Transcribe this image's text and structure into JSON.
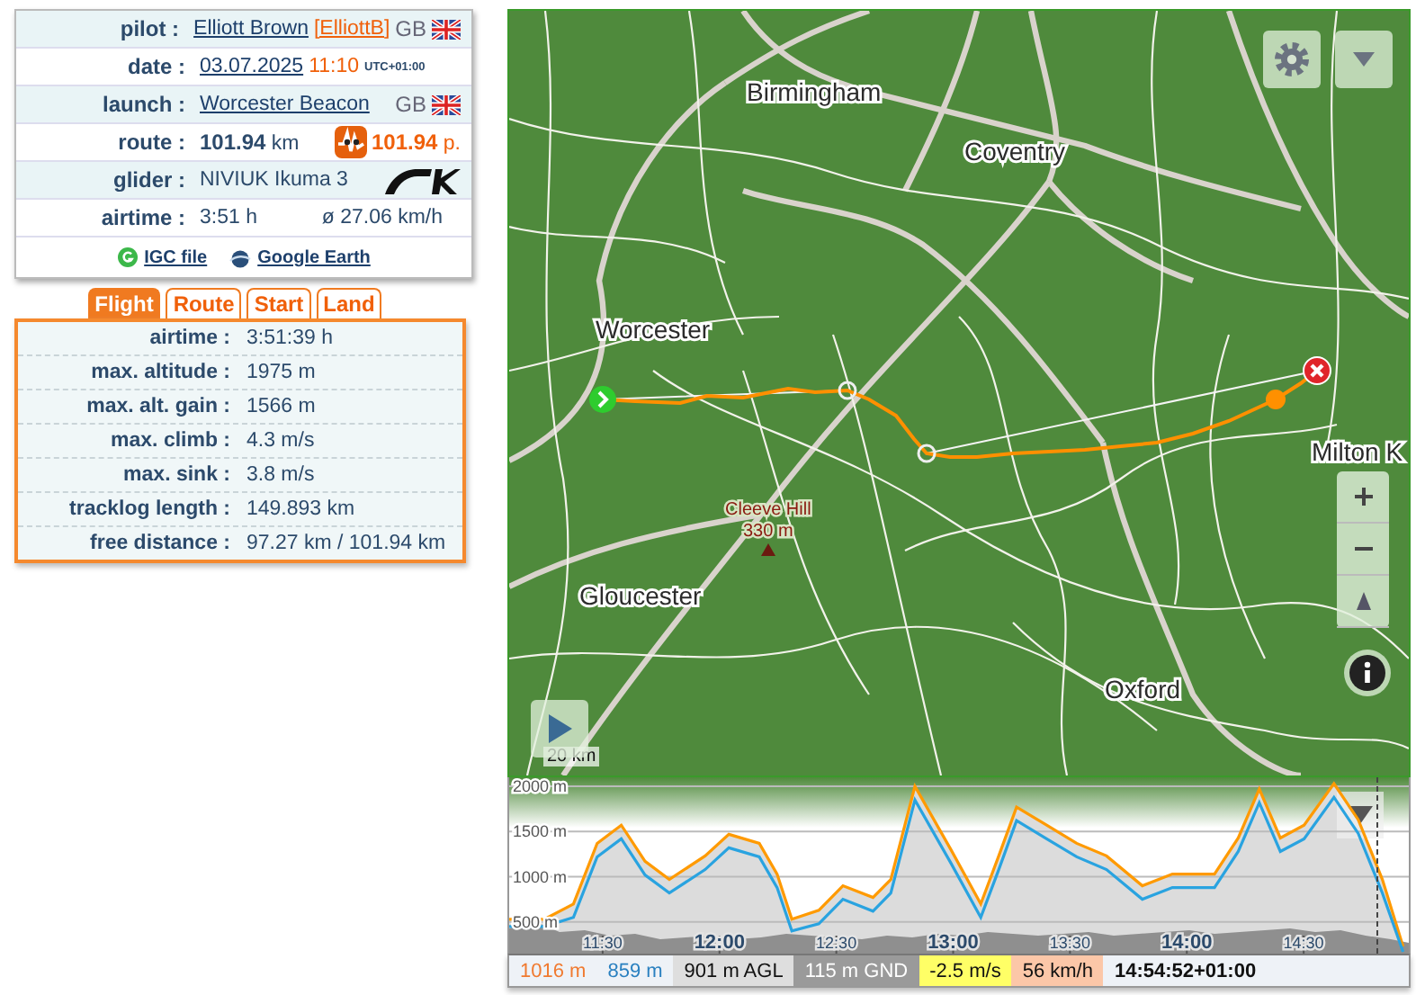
{
  "flight_info": {
    "rows": [
      {
        "kind": "pilot",
        "label": "pilot :",
        "name": "Elliott Brown",
        "nickname": "[ElliottB]",
        "country": "GB"
      },
      {
        "kind": "date",
        "label": "date :",
        "date": "03.07.2025",
        "time": "11:10",
        "timezone": "UTC+01:00"
      },
      {
        "kind": "launch",
        "label": "launch :",
        "site": "Worcester Beacon",
        "country": "GB"
      },
      {
        "kind": "route",
        "label": "route :",
        "distance": "101.94",
        "unit": "km",
        "points": "101.94",
        "points_unit": "p."
      },
      {
        "kind": "glider",
        "label": "glider :",
        "glider": "NIVIUK Ikuma 3"
      },
      {
        "kind": "airtime",
        "label": "airtime :",
        "duration": "3:51 h",
        "average_speed": "ø 27.06 km/h"
      }
    ],
    "links": [
      {
        "kind": "igc",
        "text": "IGC file"
      },
      {
        "kind": "earth",
        "text": "Google Earth"
      }
    ]
  },
  "tabs": [
    {
      "label": "Flight",
      "selected": true
    },
    {
      "label": "Route",
      "selected": false
    },
    {
      "label": "Start",
      "selected": false
    },
    {
      "label": "Land",
      "selected": false
    }
  ],
  "stats": [
    {
      "label": "airtime :",
      "value": "3:51:39 h"
    },
    {
      "label": "max. altitude :",
      "value": "1975 m"
    },
    {
      "label": "max. alt. gain :",
      "value": "1566 m"
    },
    {
      "label": "max. climb :",
      "value": "4.3 m/s"
    },
    {
      "label": "max. sink :",
      "value": "3.8 m/s"
    },
    {
      "label": "tracklog length :",
      "value": "149.893 km"
    },
    {
      "label": "free distance :",
      "value": "97.27 km / 101.94 km"
    }
  ],
  "map": {
    "places": [
      {
        "kind": "city",
        "name": "Birmingham"
      },
      {
        "kind": "city",
        "name": "Coventry"
      },
      {
        "kind": "city",
        "name": "Worcester"
      },
      {
        "kind": "city",
        "name": "Milton K"
      },
      {
        "kind": "city",
        "name": "Gloucester"
      },
      {
        "kind": "city",
        "name": "Oxford"
      },
      {
        "kind": "peak",
        "name": "Cleeve Hill",
        "elevation": "330 m"
      }
    ],
    "scale": "20 km"
  },
  "elevation_chart": {
    "chart_data": {
      "type": "line",
      "x": [
        666,
        675,
        682.5,
        688.6,
        694.8,
        700.9,
        707.1,
        716.3,
        722.4,
        730.2,
        734.8,
        738.6,
        745.5,
        751.7,
        759.4,
        764,
        770.2,
        779.4,
        787.1,
        791.7,
        796.3,
        804,
        811.7,
        819.4,
        828.6,
        836.3,
        847.1,
        853.2,
        858.6,
        864,
        870.1,
        877.8,
        884,
        890.2,
        895.5
      ],
      "series": [
        {
          "color": "#ff9a00",
          "values": [
            530,
            530,
            700,
            1370,
            1570,
            1170,
            970,
            1230,
            1470,
            1370,
            1030,
            530,
            630,
            900,
            770,
            970,
            2000,
            1300,
            700,
            1230,
            1770,
            1570,
            1370,
            1230,
            900,
            1030,
            1030,
            1430,
            1970,
            1430,
            1570,
            2030,
            1630,
            970,
            230
          ]
        },
        {
          "color": "#29a3e0",
          "values": [
            450,
            450,
            550,
            1220,
            1420,
            1020,
            820,
            1080,
            1320,
            1220,
            880,
            400,
            480,
            750,
            620,
            820,
            1850,
            1150,
            550,
            1080,
            1620,
            1420,
            1220,
            1080,
            750,
            880,
            880,
            1280,
            1820,
            1280,
            1420,
            1880,
            1480,
            820,
            170
          ]
        }
      ],
      "xlim": [
        666,
        897
      ],
      "ylim": [
        150,
        2100
      ],
      "grid": true,
      "xticks": [
        {
          "value": 690,
          "label": "11:30"
        },
        {
          "value": 720,
          "label": "12:00"
        },
        {
          "value": 750,
          "label": "12:30"
        },
        {
          "value": 780,
          "label": "13:00"
        },
        {
          "value": 810,
          "label": "13:30"
        },
        {
          "value": 840,
          "label": "14:00"
        },
        {
          "value": 870,
          "label": "14:30"
        }
      ],
      "yticks": [
        {
          "value": 500,
          "label": "500 m"
        },
        {
          "value": 1000,
          "label": "1000 m"
        },
        {
          "value": 1500,
          "label": "1500 m"
        },
        {
          "value": 2000,
          "label": "2000 m"
        }
      ]
    }
  },
  "status_bar": [
    {
      "kind": "gps",
      "text": "1016 m"
    },
    {
      "kind": "baro",
      "text": "859 m"
    },
    {
      "kind": "agl",
      "text": "901 m AGL"
    },
    {
      "kind": "gnd",
      "text": "115 m GND"
    },
    {
      "kind": "vario",
      "text": "-2.5 m/s"
    },
    {
      "kind": "speed",
      "text": "56 km/h"
    },
    {
      "kind": "time",
      "text": "14:54:52+01:00"
    }
  ]
}
